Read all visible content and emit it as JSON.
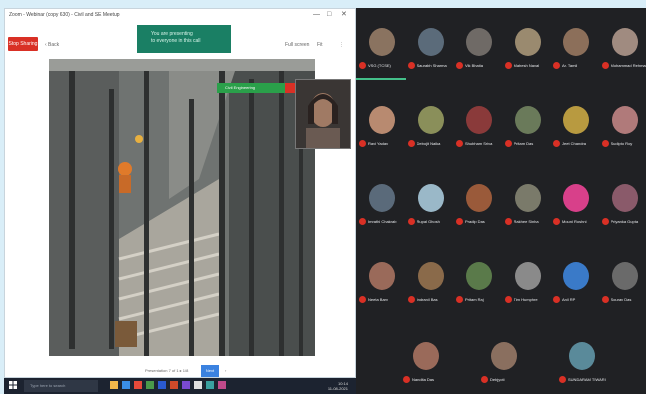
{
  "window": {
    "title": "Zoom - Webinar (copy 630) - Civil and SE Meetup",
    "min": "—",
    "max": "□",
    "close": "✕"
  },
  "toolbar": {
    "stop_label": "Stop Sharing",
    "prev_label": "‹ Back",
    "present_line1": "You are presenting",
    "present_line2": "to everyone in this call",
    "right_items": [
      "Full screen",
      "Fit",
      "⋮"
    ]
  },
  "presenter": {
    "strip_label": "Civil Engineering"
  },
  "pagination": {
    "prefix": "Presentation 7 of 1 ▸ 1/8",
    "current": "Next",
    "suffix": "›"
  },
  "taskbar": {
    "search_placeholder": "Type here to search",
    "time": "10:14",
    "date": "11-08-2021"
  },
  "participants": [
    {
      "name": "VSG (TCSE)",
      "color": "#8a7360",
      "speaking": true
    },
    {
      "name": "Saurabh Sharma",
      "color": "#5b6b7a"
    },
    {
      "name": "Vik Bhatia",
      "color": "#6f6a66"
    },
    {
      "name": "Mahesh Naval",
      "color": "#9a8a6f"
    },
    {
      "name": "Ar. Tamil",
      "color": "#8c6f5a"
    },
    {
      "name": "Mohammad Rehman",
      "color": "#a08b80"
    },
    {
      "name": "Ravi Yadav",
      "color": "#b88a70"
    },
    {
      "name": "Debojit Naika",
      "color": "#8a8f5a"
    },
    {
      "name": "Shubham Sriva",
      "color": "#8a3a3a"
    },
    {
      "name": "Pritam Das",
      "color": "#6a7a5a"
    },
    {
      "name": "Jeet Chandra",
      "color": "#b89a40"
    },
    {
      "name": "Sudipto Roy",
      "color": "#b07a7a"
    },
    {
      "name": "Imrathi Chakrab",
      "color": "#5a6a7a"
    },
    {
      "name": "Rupal Ghosh",
      "color": "#9ab8c8"
    },
    {
      "name": "Pradip Das",
      "color": "#9a5a3a"
    },
    {
      "name": "Rakhee Sinha",
      "color": "#7a7a6a"
    },
    {
      "name": "Mouni Roshni",
      "color": "#d8408a"
    },
    {
      "name": "Priyanka Gupta",
      "color": "#8a5a6a"
    },
    {
      "name": "Neeta Barv",
      "color": "#9a6a5a"
    },
    {
      "name": "Indranil Bas",
      "color": "#8a6a4a"
    },
    {
      "name": "Pritam Raj",
      "color": "#5a7a4a"
    },
    {
      "name": "Tim Humphre",
      "color": "#8a8a8a"
    },
    {
      "name": "Anil RP",
      "color": "#3a7ac8"
    },
    {
      "name": "Sourav Das",
      "color": "#6a6a6a"
    },
    {
      "name": "Nandita Das",
      "color": "#9a6a5a"
    },
    {
      "name": "Debjyoti",
      "color": "#8a6f5f"
    },
    {
      "name": "SUNDARAM TIWARI",
      "color": "#5a8a9a"
    }
  ],
  "colors": {
    "stop": "#d93025",
    "toast": "#1a7f64",
    "grid_bg": "#202124",
    "desktop": "#d9eef8"
  }
}
